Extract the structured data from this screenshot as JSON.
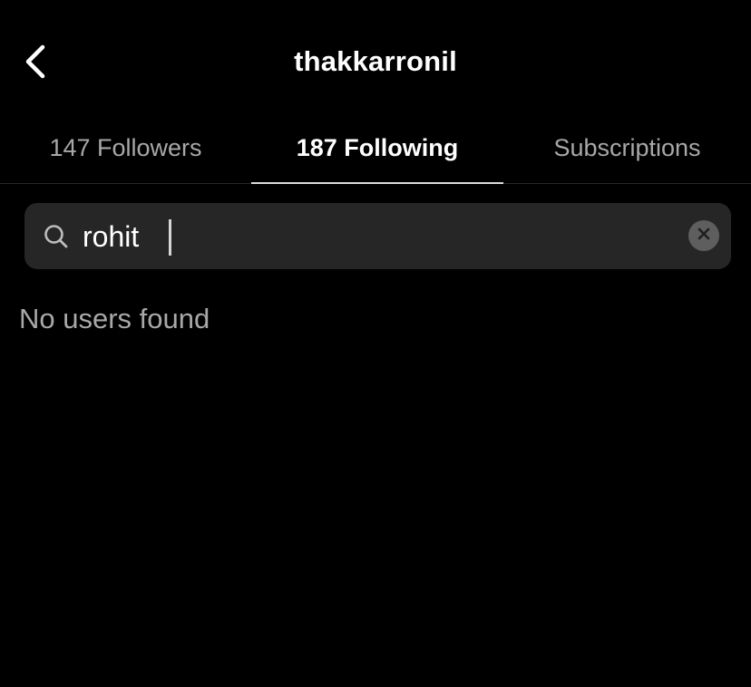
{
  "header": {
    "title": "thakkarronil",
    "back_icon": "chevron-left-icon"
  },
  "tabs": [
    {
      "label": "147 Followers",
      "active": false
    },
    {
      "label": "187 Following",
      "active": true
    },
    {
      "label": "Subscriptions",
      "active": false
    }
  ],
  "search": {
    "value": "rohit",
    "search_icon": "search-icon",
    "clear_icon": "clear-icon"
  },
  "results": {
    "empty_message": "No users found"
  },
  "colors": {
    "background": "#000000",
    "search_field": "#262626",
    "inactive_text": "#a8a8a8",
    "active_text": "#ffffff",
    "tab_indicator": "#dcdcdc"
  }
}
